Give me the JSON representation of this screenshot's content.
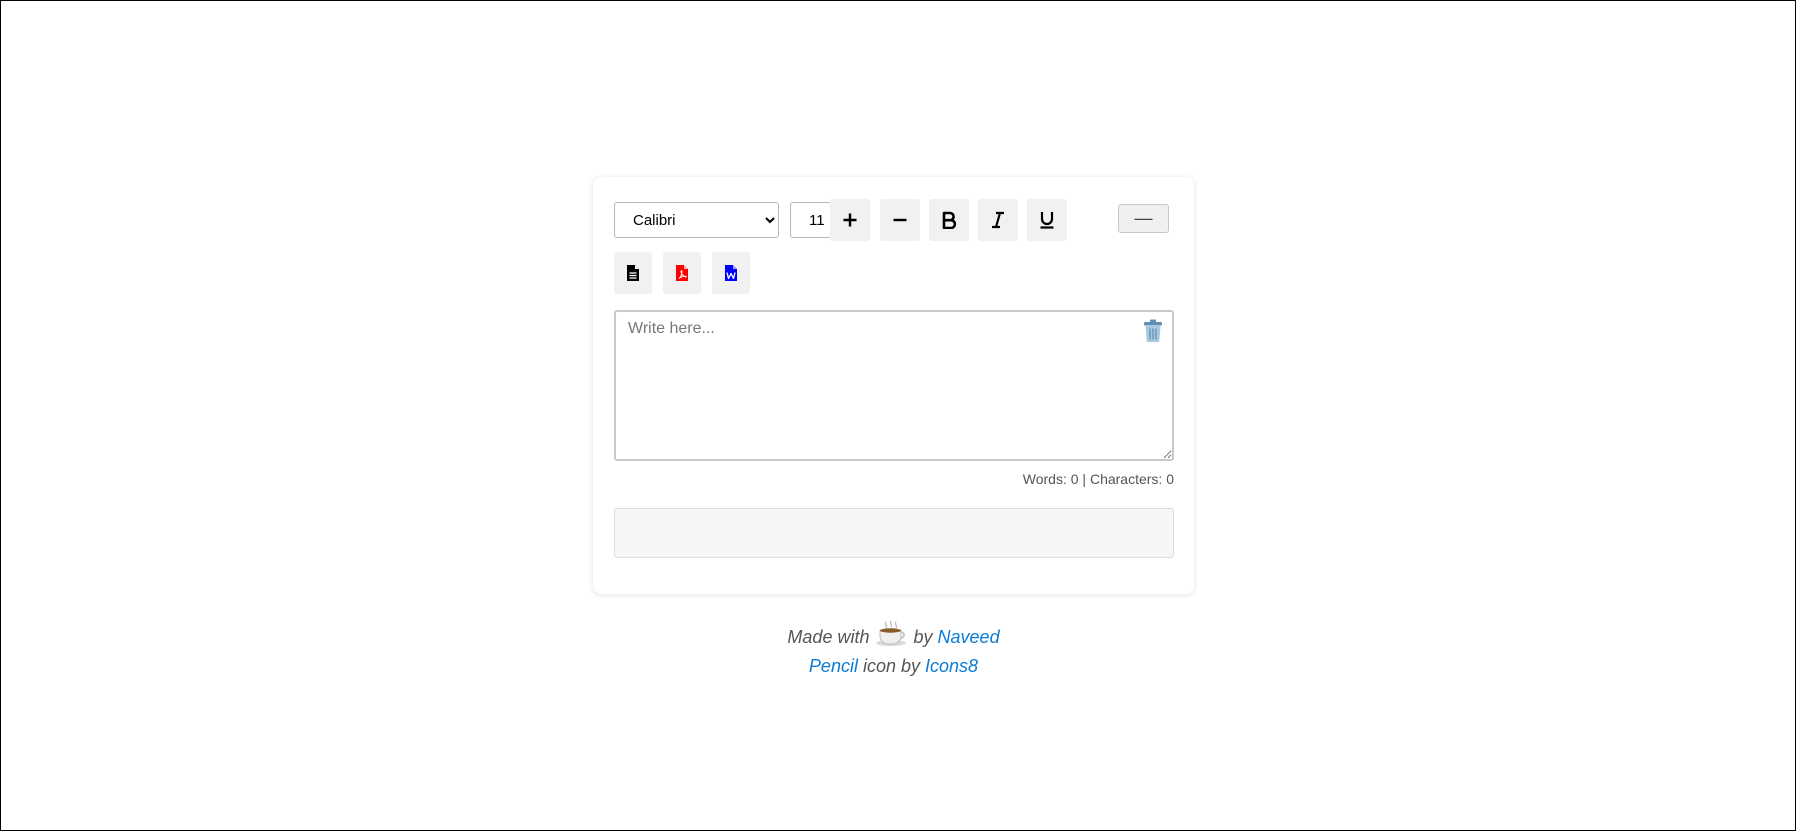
{
  "toolbar": {
    "font_family": {
      "selected": "Calibri",
      "options": [
        "Calibri"
      ]
    },
    "font_size": {
      "selected": "11",
      "options": [
        "11"
      ]
    },
    "buttons": [
      {
        "name": "increase-size",
        "icon": "plus-icon"
      },
      {
        "name": "decrease-size",
        "icon": "minus-icon"
      },
      {
        "name": "bold",
        "icon": "bold-icon"
      },
      {
        "name": "italic",
        "icon": "italic-icon"
      },
      {
        "name": "underline",
        "icon": "underline-icon"
      },
      {
        "name": "horizontal-rule",
        "icon": "horizontal-line-icon"
      }
    ],
    "horizontal_rule_label": "—"
  },
  "export": {
    "buttons": [
      {
        "name": "export-text",
        "icon": "text-file-icon",
        "color": "#000000"
      },
      {
        "name": "export-pdf",
        "icon": "pdf-file-icon",
        "color": "#ff0000"
      },
      {
        "name": "export-word",
        "icon": "word-file-icon",
        "color": "#0000ff"
      }
    ]
  },
  "editor": {
    "placeholder": "Write here...",
    "value": "",
    "clear_icon": "trash-icon"
  },
  "stats": {
    "words_label": "Words:",
    "words": "0",
    "separator": "|",
    "chars_label": "Characters:",
    "chars": "0"
  },
  "footer": {
    "made_with": "Made with",
    "coffee_icon": "coffee-icon",
    "by": "by",
    "author": "Naveed",
    "icon_name": "Pencil",
    "icon_by": "icon by",
    "icon_source": "Icons8"
  },
  "colors": {
    "link": "#0a7bd6",
    "pdf_icon": "#ff0000",
    "word_icon": "#0000ff",
    "button_bg": "#f1f1f1"
  }
}
